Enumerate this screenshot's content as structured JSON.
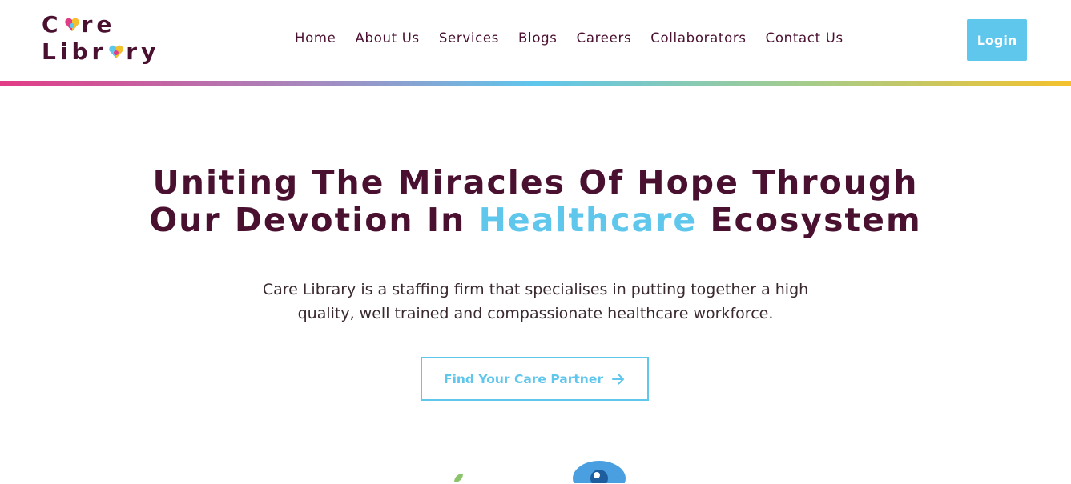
{
  "brand": {
    "line1_a": "C",
    "line1_b": "re",
    "line2_a": "Libr",
    "line2_b": "ry",
    "colors": {
      "primary": "#4a1030",
      "accent": "#5fc6ec",
      "pink": "#e23c86",
      "yellow": "#f4c12c"
    }
  },
  "nav": {
    "items": [
      {
        "label": "Home"
      },
      {
        "label": "About Us"
      },
      {
        "label": "Services"
      },
      {
        "label": "Blogs"
      },
      {
        "label": "Careers"
      },
      {
        "label": "Collaborators"
      },
      {
        "label": "Contact Us"
      }
    ],
    "login_label": "Login"
  },
  "hero": {
    "title_line1": "Uniting The Miracles Of Hope Through",
    "title_line2_pre": "Our Devotion In ",
    "title_line2_accent": "Healthcare",
    "title_line2_post": " Ecosystem",
    "description_line1": "Care Library is a staffing firm that specialises in putting together a high",
    "description_line2": "quality, well trained and compassionate healthcare workforce.",
    "cta_label": "Find Your Care Partner",
    "cta_icon": "arrow-right-icon"
  }
}
